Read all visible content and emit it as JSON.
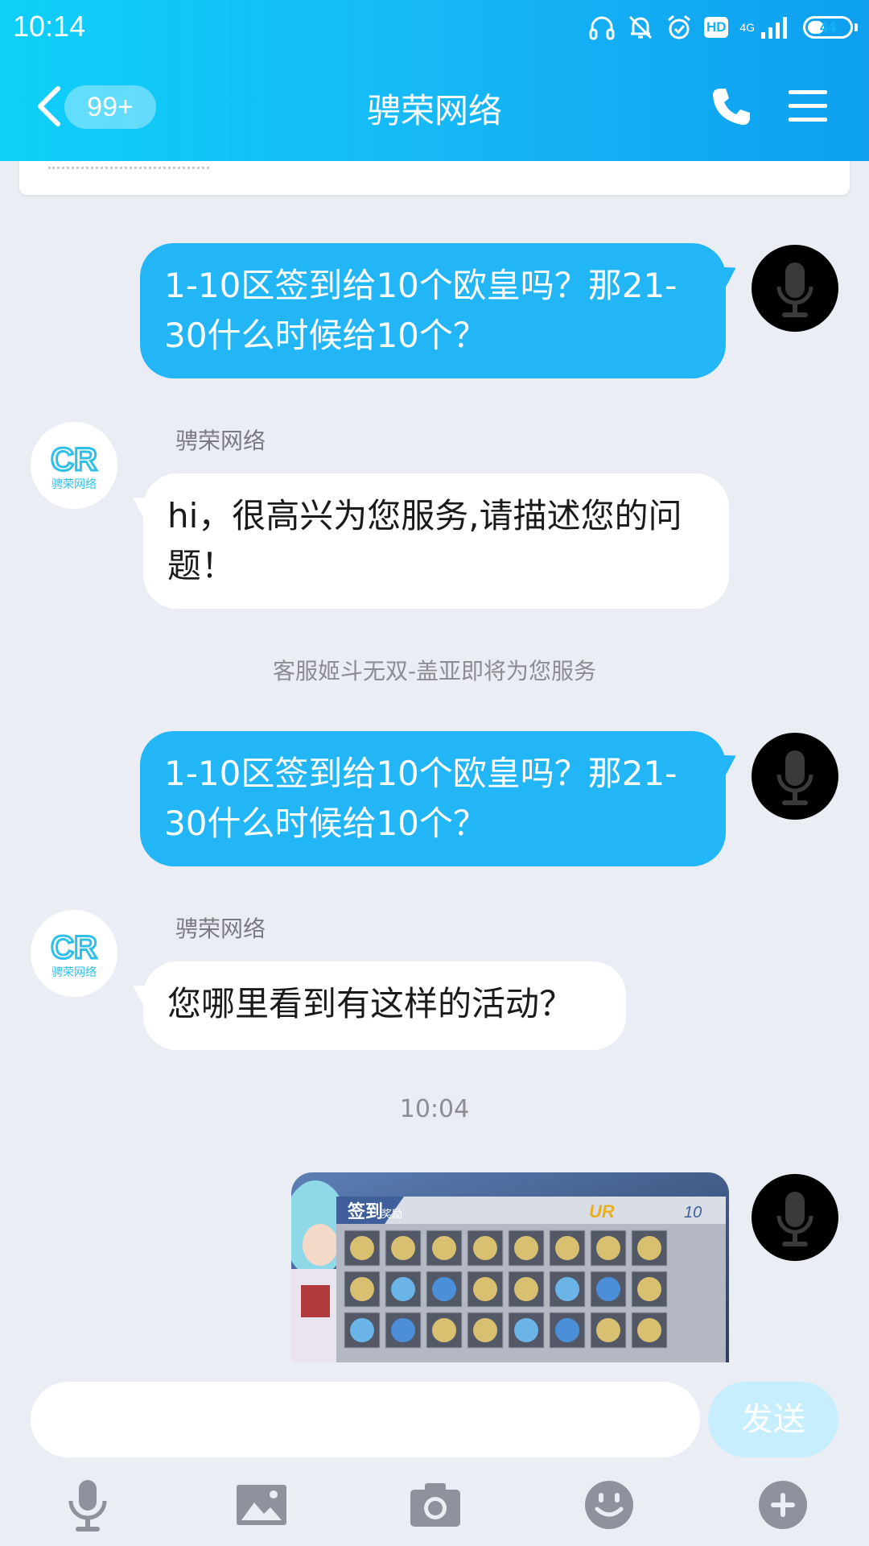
{
  "status_bar": {
    "time": "10:14",
    "network": "4G",
    "hd_label": "HD",
    "battery": "44"
  },
  "header": {
    "unread_badge": "99+",
    "title": "骋荣网络"
  },
  "messages": [
    {
      "text": "1-10区签到给10个欧皇吗？那21-30什么时候给10个？"
    },
    {
      "sender": "骋荣网络",
      "text": "hi，很高兴为您服务,请描述您的问题！"
    },
    {
      "system": "客服姬斗无双-盖亚即将为您服务"
    },
    {
      "text": "1-10区签到给10个欧皇吗？那21-30什么时候给10个？"
    },
    {
      "sender": "骋荣网络",
      "text": "您哪里看到有这样的活动？"
    },
    {
      "timestamp": "10:04"
    }
  ],
  "image_message": {
    "title": "签到",
    "subtitle": "奖励",
    "banner": "UR",
    "count": "10"
  },
  "avatar_logo": {
    "mark": "CR",
    "brand": "骋荣网络"
  },
  "composer": {
    "placeholder": "",
    "send_label": "发送"
  },
  "colors": {
    "header_gradient_start": "#0ed0f8",
    "header_gradient_end": "#0e9ff0",
    "outgoing_bubble": "#22b6f6",
    "incoming_bubble": "#ffffff",
    "chat_background": "#ebedf5",
    "send_button": "#c6eefc"
  },
  "icons": {
    "back": "chevron-left-icon",
    "call": "phone-icon",
    "menu": "menu-icon",
    "voice": "microphone-icon",
    "image": "image-icon",
    "camera": "camera-icon",
    "emoji": "emoji-icon",
    "more": "plus-icon"
  }
}
